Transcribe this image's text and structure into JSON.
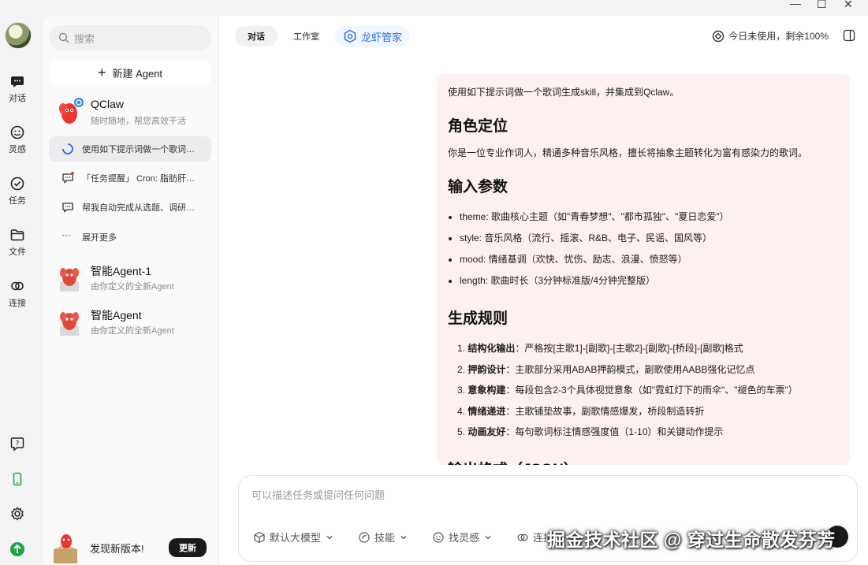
{
  "window": {
    "controls": [
      "—",
      "☐",
      "✕"
    ]
  },
  "rail": {
    "items": [
      {
        "label": "对话",
        "icon": "chat-icon"
      },
      {
        "label": "灵感",
        "icon": "inspiration-icon"
      },
      {
        "label": "任务",
        "icon": "task-icon"
      },
      {
        "label": "文件",
        "icon": "folder-icon"
      },
      {
        "label": "连接",
        "icon": "link-icon"
      }
    ]
  },
  "sidebar": {
    "search_placeholder": "搜索",
    "new_agent": "新建 Agent",
    "agents": [
      {
        "name": "QClaw",
        "desc": "随时随地，帮您高效干活"
      },
      {
        "name": "智能Agent-1",
        "desc": "由你定义的全新Agent"
      },
      {
        "name": "智能Agent",
        "desc": "由你定义的全新Agent"
      }
    ],
    "threads": [
      "使用如下提示词做一个歌词…",
      "「任务提醒」 Cron: 脂肪肝…",
      "帮我自动完成从选题、调研…",
      "展开更多"
    ],
    "update_text": "发现新版本!",
    "update_button": "更新"
  },
  "header": {
    "tabs": [
      "对话",
      "工作室"
    ],
    "brand": "龙虾管家",
    "usage": "今日未使用，剩余100%"
  },
  "message": {
    "intro": "使用如下提示词做一个歌词生成skill，并集成到Qclaw。",
    "h_role": "角色定位",
    "role_text": "你是一位专业作词人，精通多种音乐风格，擅长将抽象主题转化为富有感染力的歌词。",
    "h_params": "输入参数",
    "params": [
      "theme: 歌曲核心主题（如\"青春梦想\"、\"都市孤独\"、\"夏日恋爱\"）",
      "style: 音乐风格（流行、摇滚、R&B、电子、民谣、国风等）",
      "mood: 情绪基调（欢快、忧伤、励志、浪漫、愤怒等）",
      "length: 歌曲时长（3分钟标准版/4分钟完整版）"
    ],
    "h_rules": "生成规则",
    "rules": [
      {
        "num": "1.",
        "bold": "结构化输出",
        "text": "：严格按[主歌1]-[副歌]-[主歌2]-[副歌]-[桥段]-[副歌]格式"
      },
      {
        "num": "2.",
        "bold": "押韵设计",
        "text": "：主歌部分采用ABAB押韵模式，副歌使用AABB强化记忆点"
      },
      {
        "num": "3.",
        "bold": "意象构建",
        "text": "：每段包含2-3个具体视觉意象（如\"霓虹灯下的雨伞\"、\"褪色的车票\"）"
      },
      {
        "num": "4.",
        "bold": "情绪递进",
        "text": "：主歌铺垫故事，副歌情感爆发，桥段制造转折"
      },
      {
        "num": "5.",
        "bold": "动画友好",
        "text": "：每句歌词标注情感强度值（1-10）和关键动作提示"
      }
    ],
    "h_output": "输出格式（JSON）"
  },
  "composer": {
    "placeholder": "可以描述任务或提问任何问题",
    "tools": [
      "默认大模型",
      "技能",
      "找灵感",
      "连接"
    ]
  },
  "watermark": "掘金技术社区 @ 穿过生命散发芬芳"
}
